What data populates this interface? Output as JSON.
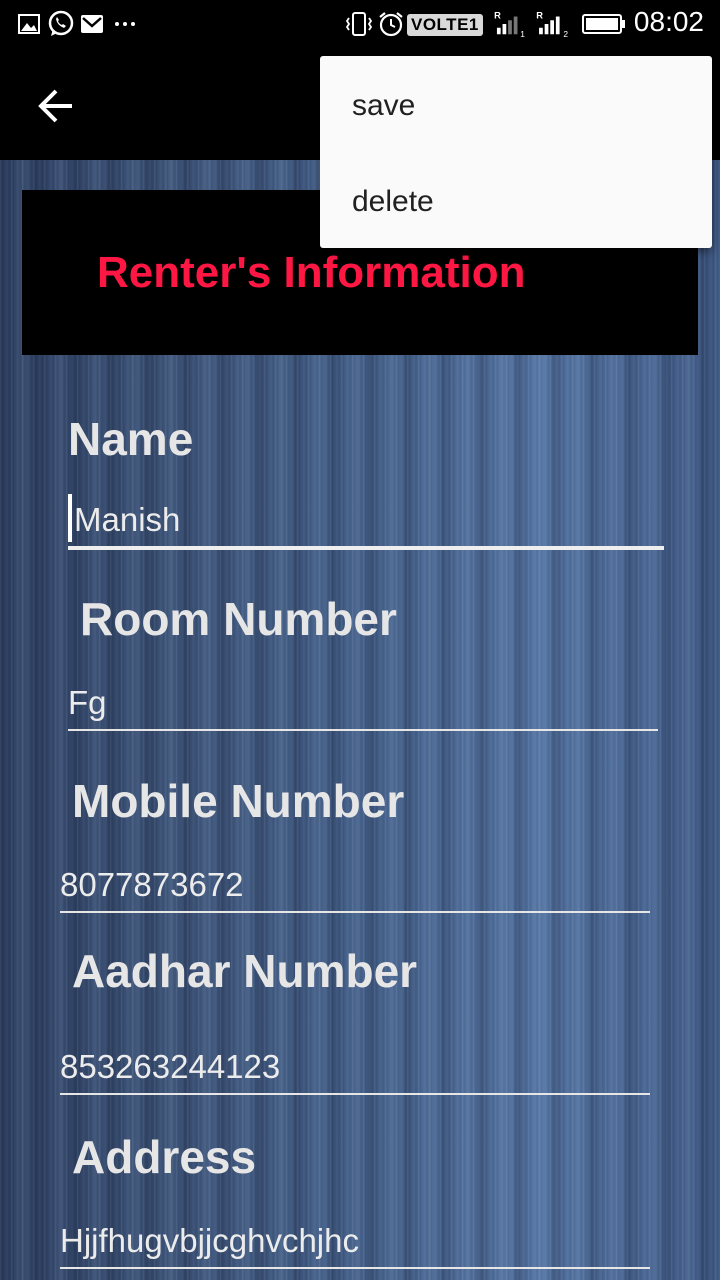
{
  "status_bar": {
    "time": "08:02",
    "volte": "VOLTE1",
    "notification_icons": [
      "gallery-icon",
      "whatsapp-icon",
      "gmail-icon",
      "more-dots-icon"
    ],
    "system_icons": [
      "vibrate-icon",
      "alarm-icon",
      "signal-sim1-icon",
      "signal-sim2-icon",
      "battery-icon"
    ]
  },
  "app_bar": {
    "back_icon": "arrow-back-icon"
  },
  "menu": {
    "items": [
      {
        "label": "save"
      },
      {
        "label": "delete"
      }
    ]
  },
  "header": {
    "title": "Renter's Information",
    "title_color": "#ff1744"
  },
  "form": {
    "name": {
      "label": "Name",
      "value": "Manish"
    },
    "room": {
      "label": "Room Number",
      "value": "Fg"
    },
    "mobile": {
      "label": "Mobile Number",
      "value": "8077873672"
    },
    "aadhar": {
      "label": "Aadhar Number",
      "value": "853263244123"
    },
    "address": {
      "label": "Address",
      "value": "Hjjfhugvbjjcghvchjhc"
    }
  }
}
